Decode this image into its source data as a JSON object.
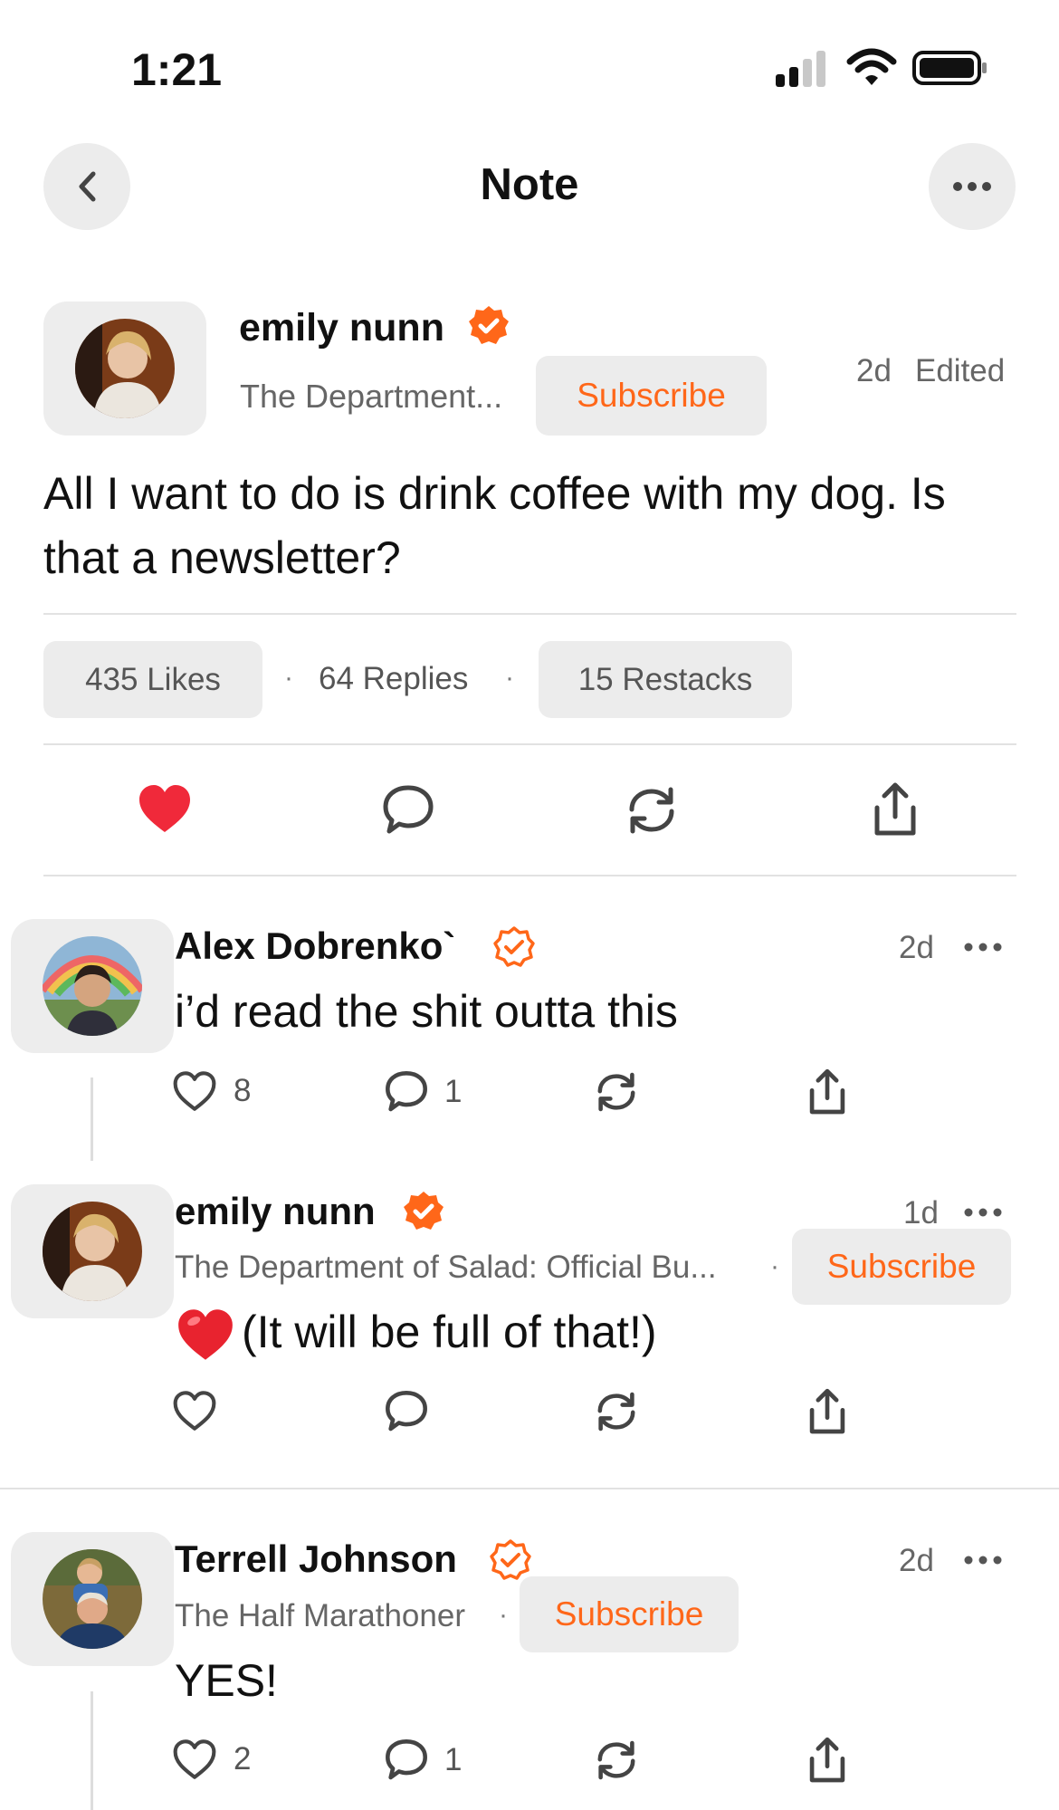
{
  "status_bar": {
    "time": "1:21"
  },
  "header": {
    "title": "Note"
  },
  "post": {
    "author": "emily nunn",
    "publication": "The Department...",
    "subscribe_label": "Subscribe",
    "timestamp": "2d",
    "edited": "Edited",
    "body": "All I want to do is drink coffee with my dog. Is that a newsletter?",
    "stats": {
      "likes": "435 Likes",
      "replies": "64 Replies",
      "restacks": "15 Restacks"
    }
  },
  "replies": [
    {
      "author": "Alex Dobrenko`",
      "timestamp": "2d",
      "body": "i’d read the shit outta this",
      "like_count": "8",
      "comment_count": "1"
    },
    {
      "author": "emily nunn",
      "publication": "The Department of Salad: Official Bu...",
      "subscribe_label": "Subscribe",
      "timestamp": "1d",
      "body": "(It will be full of that!)"
    },
    {
      "author": "Terrell Johnson",
      "publication": "The Half Marathoner",
      "subscribe_label": "Subscribe",
      "timestamp": "2d",
      "body": "YES!",
      "like_count": "2",
      "comment_count": "1"
    }
  ],
  "colors": {
    "accent": "#ff6719",
    "like_red": "#f0293a",
    "pill_bg": "#ececec"
  }
}
